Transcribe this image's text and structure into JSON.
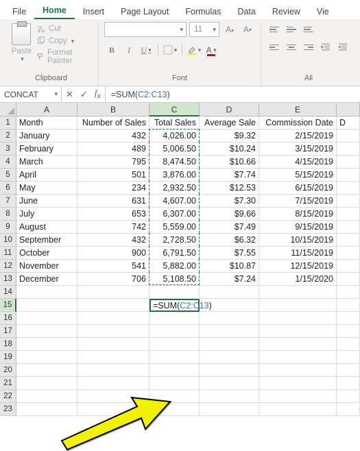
{
  "tabs": {
    "file": "File",
    "home": "Home",
    "insert": "Insert",
    "pagelayout": "Page Layout",
    "formulas": "Formulas",
    "data": "Data",
    "review": "Review",
    "view": "Vie"
  },
  "clipboard": {
    "cut": "Cut",
    "copy": "Copy",
    "formatpainter": "Format Painter",
    "paste": "Paste",
    "group": "Clipboard"
  },
  "font": {
    "size": "11",
    "group": "Font"
  },
  "align": {
    "group": "Ali"
  },
  "namebox": "CONCAT",
  "formula_parts": {
    "pre": "=SUM(",
    "ref": "C2:C13",
    "post": ")"
  },
  "columns": [
    "A",
    "B",
    "C",
    "D",
    "E"
  ],
  "headers": {
    "A": "Month",
    "B": "Number of Sales",
    "C": "Total Sales",
    "D": "Average Sale",
    "E": "Commission Date",
    "F": "D"
  },
  "rows": [
    {
      "A": "January",
      "B": "432",
      "C": "4,026.00",
      "D": "$9.32",
      "E": "2/15/2019"
    },
    {
      "A": "February",
      "B": "489",
      "C": "5,006.50",
      "D": "$10.24",
      "E": "3/15/2019"
    },
    {
      "A": "March",
      "B": "795",
      "C": "8,474.50",
      "D": "$10.66",
      "E": "4/15/2019"
    },
    {
      "A": "April",
      "B": "501",
      "C": "3,876.00",
      "D": "$7.74",
      "E": "5/15/2019"
    },
    {
      "A": "May",
      "B": "234",
      "C": "2,932.50",
      "D": "$12.53",
      "E": "6/15/2019"
    },
    {
      "A": "June",
      "B": "631",
      "C": "4,607.00",
      "D": "$7.30",
      "E": "7/15/2019"
    },
    {
      "A": "July",
      "B": "653",
      "C": "6,307.00",
      "D": "$9.66",
      "E": "8/15/2019"
    },
    {
      "A": "August",
      "B": "742",
      "C": "5,559.00",
      "D": "$7.49",
      "E": "9/15/2019"
    },
    {
      "A": "September",
      "B": "432",
      "C": "2,728.50",
      "D": "$6.32",
      "E": "10/15/2019"
    },
    {
      "A": "October",
      "B": "900",
      "C": "6,791.50",
      "D": "$7.55",
      "E": "11/15/2019"
    },
    {
      "A": "November",
      "B": "541",
      "C": "5,882.00",
      "D": "$10.87",
      "E": "12/15/2019"
    },
    {
      "A": "December",
      "B": "706",
      "C": "5,108.50",
      "D": "$7.24",
      "E": "1/15/2020"
    }
  ]
}
